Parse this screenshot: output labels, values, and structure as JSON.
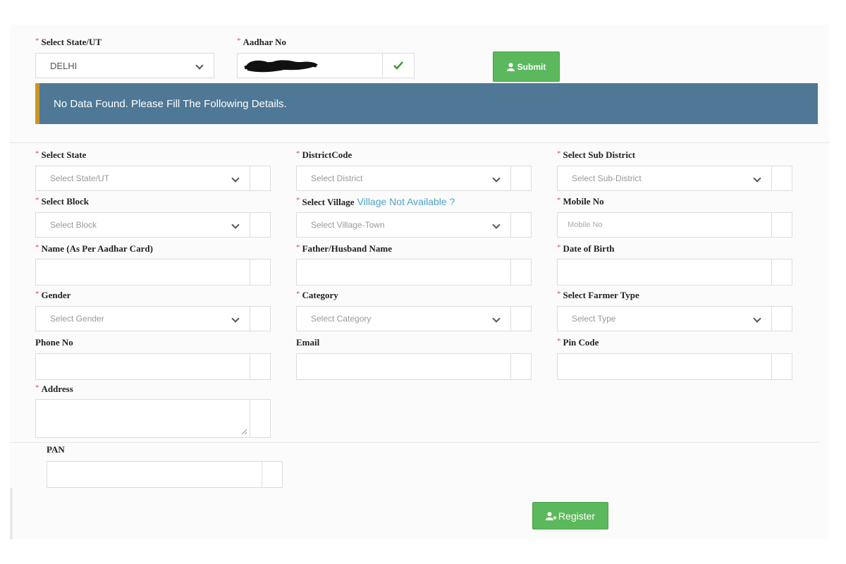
{
  "top": {
    "state": {
      "label": "Select State/UT",
      "value": "DELHI"
    },
    "aadhar": {
      "label": "Aadhar No"
    },
    "submit_label": "Submit"
  },
  "alert": {
    "text": "No Data Found. Please Fill The Following Details."
  },
  "form": {
    "state": {
      "label": "Select State",
      "placeholder": "Select State/UT"
    },
    "district": {
      "label": "DistrictCode",
      "placeholder": "Select District"
    },
    "subdistrict": {
      "label": "Select Sub District",
      "placeholder": "Select Sub-District"
    },
    "block": {
      "label": "Select Block",
      "placeholder": "Select Block"
    },
    "village": {
      "label": "Select Village",
      "link": "Village Not Available ?",
      "placeholder": "Select Village-Town"
    },
    "mobile": {
      "label": "Mobile No",
      "placeholder": "Mobile No"
    },
    "name": {
      "label": "Name (As Per Aadhar Card)"
    },
    "father": {
      "label": "Father/Husband Name"
    },
    "dob": {
      "label": "Date of Birth"
    },
    "gender": {
      "label": "Gender",
      "placeholder": "Select Gender"
    },
    "category": {
      "label": "Category",
      "placeholder": "Select Category"
    },
    "farmer_type": {
      "label": "Select Farmer Type",
      "placeholder": "Select Type"
    },
    "phone": {
      "label": "Phone No"
    },
    "email": {
      "label": "Email"
    },
    "pincode": {
      "label": "Pin Code"
    },
    "address": {
      "label": "Address"
    },
    "pan": {
      "label": "PAN"
    }
  },
  "register_label": "Register",
  "colors": {
    "accent_green": "#5cb85c",
    "alert_bg": "#4e7895",
    "alert_border": "#c8962b",
    "required": "#d9534f",
    "link": "#4fa3c8"
  }
}
